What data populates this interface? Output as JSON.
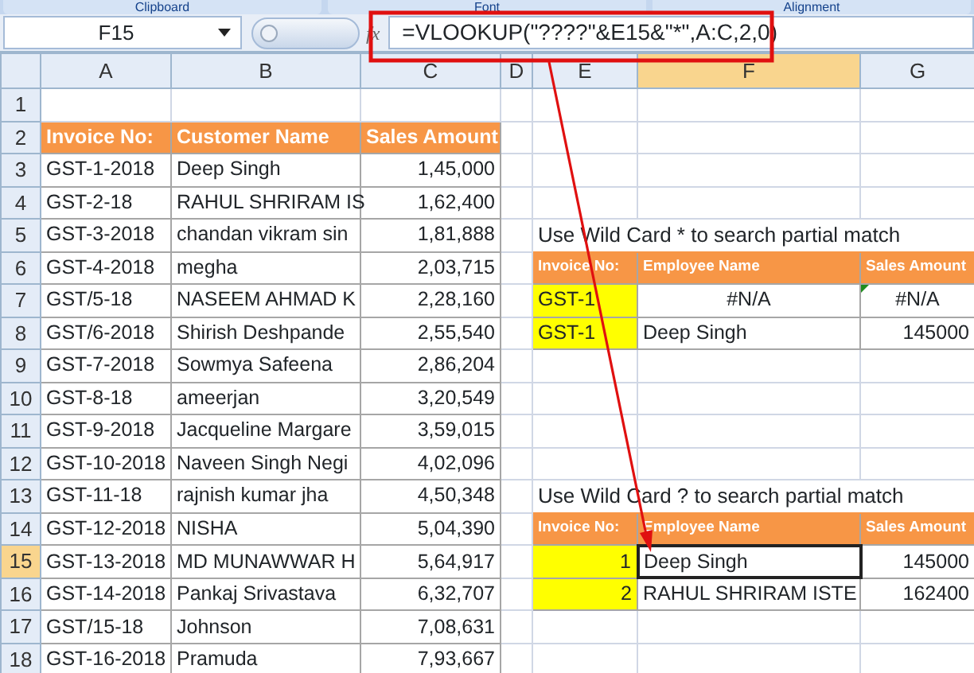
{
  "ribbon_groups": [
    "Clipboard",
    "Font",
    "Alignment"
  ],
  "formula_bar": {
    "name_box": "F15",
    "function_label": "fx",
    "formula": "=VLOOKUP(\"????\"&E15&\"*\",A:C,2,0)"
  },
  "columns": [
    {
      "label": "A",
      "selected": false
    },
    {
      "label": "B",
      "selected": false
    },
    {
      "label": "C",
      "selected": false
    },
    {
      "label": "D",
      "selected": false
    },
    {
      "label": "E",
      "selected": false
    },
    {
      "label": "F",
      "selected": true
    },
    {
      "label": "G",
      "selected": false
    }
  ],
  "rows": [
    {
      "number": "1",
      "selected": false,
      "cells": {}
    },
    {
      "number": "2",
      "selected": false,
      "cells": {
        "A": {
          "text": "Invoice No:",
          "kind": "header",
          "selected": false
        },
        "B": {
          "text": "Customer Name",
          "kind": "header",
          "selected": false
        },
        "C": {
          "text": "Sales Amount",
          "kind": "header",
          "selected": false
        }
      }
    },
    {
      "number": "3",
      "selected": false,
      "cells": {
        "A": {
          "text": "GST-1-2018",
          "kind": "text",
          "selected": false
        },
        "B": {
          "text": "Deep Singh",
          "kind": "text",
          "selected": false
        },
        "C": {
          "text": "1,45,000",
          "kind": "number",
          "selected": false
        }
      }
    },
    {
      "number": "4",
      "selected": false,
      "cells": {
        "A": {
          "text": "GST-2-18",
          "kind": "text",
          "selected": false
        },
        "B": {
          "text": "RAHUL SHRIRAM IS",
          "kind": "text",
          "selected": false
        },
        "C": {
          "text": "1,62,400",
          "kind": "number",
          "selected": false
        }
      }
    },
    {
      "number": "5",
      "selected": false,
      "cells": {
        "A": {
          "text": "GST-3-2018",
          "kind": "text",
          "selected": false
        },
        "B": {
          "text": "chandan vikram sin",
          "kind": "text",
          "selected": false
        },
        "C": {
          "text": "1,81,888",
          "kind": "number",
          "selected": false
        },
        "E": {
          "text": "Use Wild Card * to search partial match",
          "kind": "note",
          "selected": false
        }
      }
    },
    {
      "number": "6",
      "selected": false,
      "cells": {
        "A": {
          "text": "GST-4-2018",
          "kind": "text",
          "selected": false
        },
        "B": {
          "text": "megha",
          "kind": "text",
          "selected": false
        },
        "C": {
          "text": "2,03,715",
          "kind": "number",
          "selected": false
        },
        "E": {
          "text": "Invoice No:",
          "kind": "subheader",
          "selected": false
        },
        "F": {
          "text": "Employee Name",
          "kind": "subheader",
          "selected": false
        },
        "G": {
          "text": "Sales Amount",
          "kind": "subheader",
          "selected": false
        }
      }
    },
    {
      "number": "7",
      "selected": false,
      "cells": {
        "A": {
          "text": "GST/5-18",
          "kind": "text",
          "selected": false
        },
        "B": {
          "text": "NASEEM AHMAD K",
          "kind": "text",
          "selected": false
        },
        "C": {
          "text": "2,28,160",
          "kind": "number",
          "selected": false
        },
        "E": {
          "text": "GST-1",
          "kind": "lookup",
          "selected": false
        },
        "F": {
          "text": "#N/A",
          "kind": "center",
          "selected": false
        },
        "G": {
          "text": "#N/A",
          "kind": "center",
          "selected": false,
          "error_marker": true
        }
      }
    },
    {
      "number": "8",
      "selected": false,
      "cells": {
        "A": {
          "text": "GST/6-2018",
          "kind": "text",
          "selected": false
        },
        "B": {
          "text": "Shirish Deshpande",
          "kind": "text",
          "selected": false
        },
        "C": {
          "text": "2,55,540",
          "kind": "number",
          "selected": false
        },
        "E": {
          "text": "GST-1",
          "kind": "lookup",
          "selected": false
        },
        "F": {
          "text": "Deep Singh",
          "kind": "text",
          "selected": false
        },
        "G": {
          "text": "145000",
          "kind": "number",
          "selected": false
        }
      }
    },
    {
      "number": "9",
      "selected": false,
      "cells": {
        "A": {
          "text": "GST-7-2018",
          "kind": "text",
          "selected": false
        },
        "B": {
          "text": "Sowmya Safeena",
          "kind": "text",
          "selected": false
        },
        "C": {
          "text": "2,86,204",
          "kind": "number",
          "selected": false
        }
      }
    },
    {
      "number": "10",
      "selected": false,
      "cells": {
        "A": {
          "text": "GST-8-18",
          "kind": "text",
          "selected": false
        },
        "B": {
          "text": "ameerjan",
          "kind": "text",
          "selected": false
        },
        "C": {
          "text": "3,20,549",
          "kind": "number",
          "selected": false
        }
      }
    },
    {
      "number": "11",
      "selected": false,
      "cells": {
        "A": {
          "text": "GST-9-2018",
          "kind": "text",
          "selected": false
        },
        "B": {
          "text": "Jacqueline Margare",
          "kind": "text",
          "selected": false
        },
        "C": {
          "text": "3,59,015",
          "kind": "number",
          "selected": false
        }
      }
    },
    {
      "number": "12",
      "selected": false,
      "cells": {
        "A": {
          "text": "GST-10-2018",
          "kind": "text",
          "selected": false
        },
        "B": {
          "text": "Naveen Singh Negi",
          "kind": "text",
          "selected": false
        },
        "C": {
          "text": "4,02,096",
          "kind": "number",
          "selected": false
        }
      }
    },
    {
      "number": "13",
      "selected": false,
      "cells": {
        "A": {
          "text": "GST-11-18",
          "kind": "text",
          "selected": false
        },
        "B": {
          "text": "rajnish kumar jha",
          "kind": "text",
          "selected": false
        },
        "C": {
          "text": "4,50,348",
          "kind": "number",
          "selected": false
        },
        "E": {
          "text": "Use Wild Card ? to search partial match",
          "kind": "note",
          "selected": false
        }
      }
    },
    {
      "number": "14",
      "selected": false,
      "cells": {
        "A": {
          "text": "GST-12-2018",
          "kind": "text",
          "selected": false
        },
        "B": {
          "text": "NISHA",
          "kind": "text",
          "selected": false
        },
        "C": {
          "text": "5,04,390",
          "kind": "number",
          "selected": false
        },
        "E": {
          "text": "Invoice No:",
          "kind": "subheader",
          "selected": false
        },
        "F": {
          "text": "Employee Name",
          "kind": "subheader",
          "selected": false
        },
        "G": {
          "text": "Sales Amount",
          "kind": "subheader",
          "selected": false
        }
      }
    },
    {
      "number": "15",
      "selected": true,
      "cells": {
        "A": {
          "text": "GST-13-2018",
          "kind": "text",
          "selected": false
        },
        "B": {
          "text": "MD MUNAWWAR H",
          "kind": "text",
          "selected": false
        },
        "C": {
          "text": "5,64,917",
          "kind": "number",
          "selected": false
        },
        "E": {
          "text": "1",
          "kind": "lookup-number",
          "selected": false
        },
        "F": {
          "text": "Deep Singh",
          "kind": "text",
          "selected": true
        },
        "G": {
          "text": "145000",
          "kind": "number",
          "selected": false
        }
      }
    },
    {
      "number": "16",
      "selected": false,
      "cells": {
        "A": {
          "text": "GST-14-2018",
          "kind": "text",
          "selected": false
        },
        "B": {
          "text": "Pankaj Srivastava",
          "kind": "text",
          "selected": false
        },
        "C": {
          "text": "6,32,707",
          "kind": "number",
          "selected": false
        },
        "E": {
          "text": "2",
          "kind": "lookup-number",
          "selected": false
        },
        "F": {
          "text": "RAHUL SHRIRAM ISTE",
          "kind": "text",
          "selected": false
        },
        "G": {
          "text": "162400",
          "kind": "number",
          "selected": false
        }
      }
    },
    {
      "number": "17",
      "selected": false,
      "cells": {
        "A": {
          "text": "GST/15-18",
          "kind": "text",
          "selected": false
        },
        "B": {
          "text": "Johnson",
          "kind": "text",
          "selected": false
        },
        "C": {
          "text": "7,08,631",
          "kind": "number",
          "selected": false
        }
      }
    },
    {
      "number": "18",
      "selected": false,
      "cells": {
        "A": {
          "text": "GST-16-2018",
          "kind": "text",
          "selected": false
        },
        "B": {
          "text": "Pramuda",
          "kind": "text",
          "selected": false
        },
        "C": {
          "text": "7,93,667",
          "kind": "number",
          "selected": false
        }
      }
    }
  ]
}
